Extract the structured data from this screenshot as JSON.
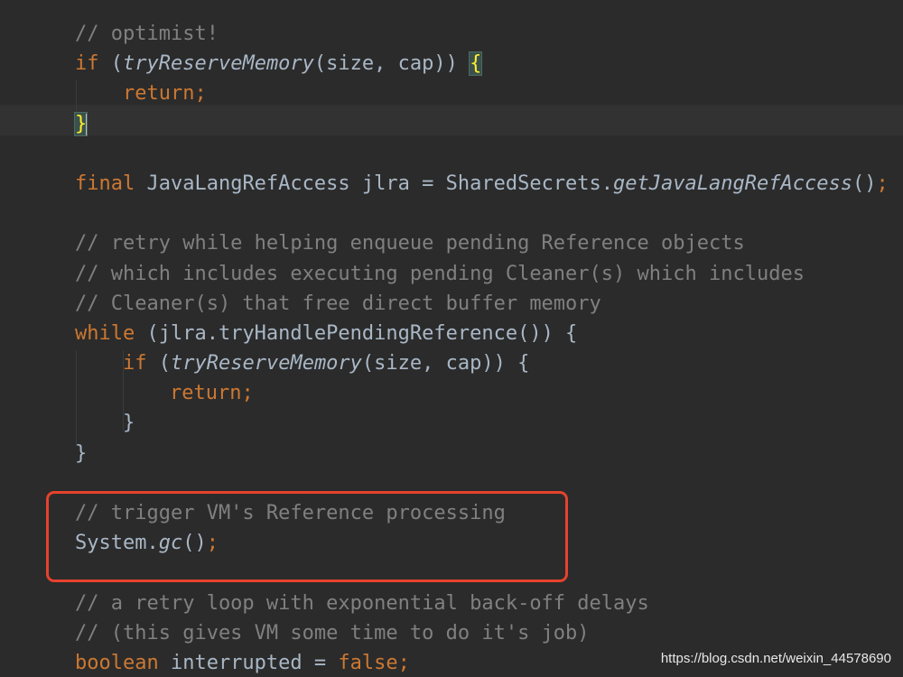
{
  "editor": {
    "theme": "darcula",
    "colors": {
      "background": "#2b2b2b",
      "keyword": "#cc7832",
      "comment": "#808080",
      "text": "#a9b7c6",
      "highlight_box": "#e6422d"
    },
    "lines": [
      {
        "comment": "// optimist!"
      },
      {
        "kw": "if",
        "open": " (",
        "call": "tryReserveMemory",
        "args": "(size, cap)) ",
        "brace": "{"
      },
      {
        "kw": "return",
        "semi": ";"
      },
      {
        "brace": "}"
      },
      {
        "text": ""
      },
      {
        "kw": "final",
        "decl": " JavaLangRefAccess jlra = SharedSecrets.",
        "call": "getJavaLangRefAccess",
        "tail": "()",
        "semi": ";"
      },
      {
        "text": ""
      },
      {
        "comment": "// retry while helping enqueue pending Reference objects"
      },
      {
        "comment": "// which includes executing pending Cleaner(s) which includes"
      },
      {
        "comment": "// Cleaner(s) that free direct buffer memory"
      },
      {
        "kw": "while",
        "rest": " (jlra.tryHandlePendingReference()) {"
      },
      {
        "kw": "if",
        "open": " (",
        "call": "tryReserveMemory",
        "args": "(size, cap)) {"
      },
      {
        "kw": "return",
        "semi": ";"
      },
      {
        "text": "}"
      },
      {
        "text": "}"
      },
      {
        "text": ""
      },
      {
        "comment": "// trigger VM's Reference processing"
      },
      {
        "pre": "System.",
        "call": "gc",
        "tail": "()",
        "semi": ";"
      },
      {
        "text": ""
      },
      {
        "comment": "// a retry loop with exponential back-off delays"
      },
      {
        "comment": "// (this gives VM some time to do it's job)"
      },
      {
        "kw": "boolean",
        "decl": " interrupted = ",
        "kw2": "false",
        "semi": ";"
      }
    ]
  },
  "watermark": "https://blog.csdn.net/weixin_44578690"
}
